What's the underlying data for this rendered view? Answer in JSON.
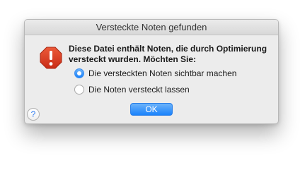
{
  "dialog": {
    "title": "Versteckte Noten gefunden",
    "icon": "stop-octagon-exclamation-icon",
    "message_line1": "Diese Datei enthält Noten, die durch Optimierung",
    "message_line2": "versteckt wurden. Möchten Sie:",
    "options": [
      {
        "label": "Die versteckten Noten sichtbar machen",
        "selected": true
      },
      {
        "label": "Die Noten versteckt lassen",
        "selected": false
      }
    ],
    "ok_label": "OK",
    "help_label": "?"
  },
  "colors": {
    "accent": "#1a82fb",
    "alert_red": "#d93a22",
    "dialog_bg": "#ececec"
  }
}
